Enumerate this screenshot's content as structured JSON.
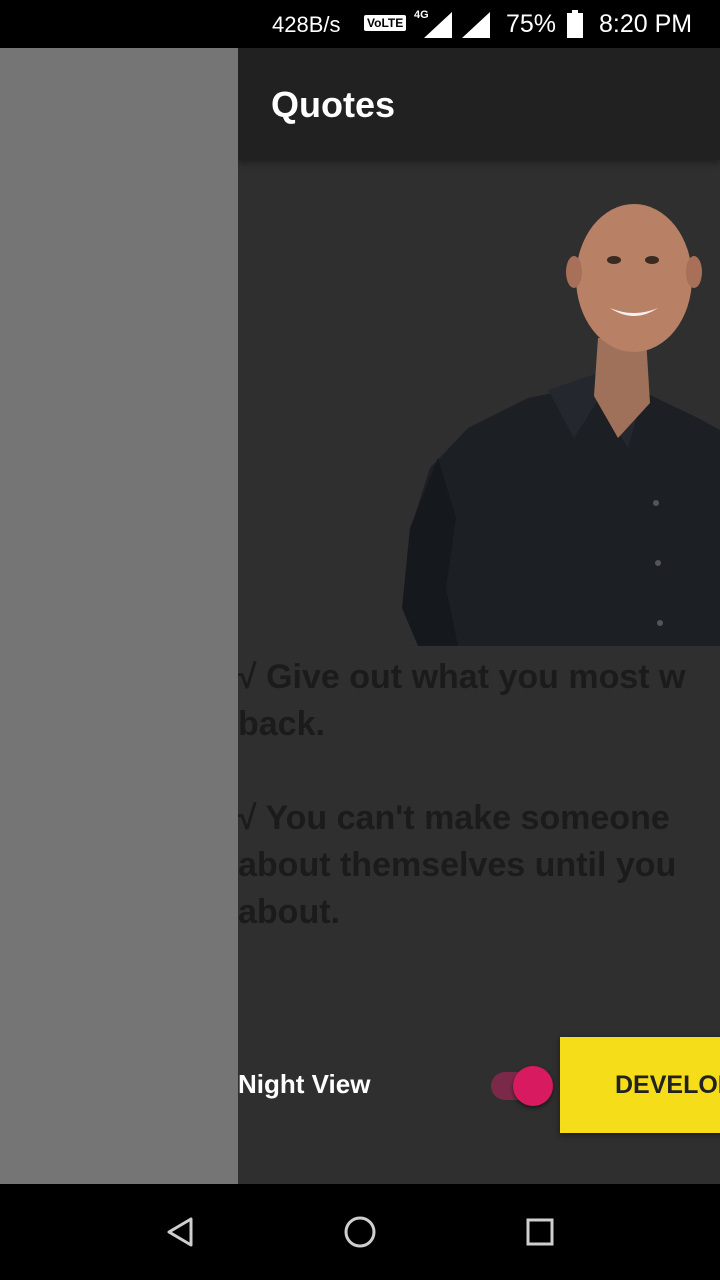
{
  "status_bar": {
    "net_speed": "428B/s",
    "volte": "VoLTE",
    "network_type": "4G",
    "battery_percent": "75%",
    "time": "8:20 PM"
  },
  "app": {
    "title": "Quotes",
    "quotes": [
      {
        "line1": "√ Give out what you most w",
        "line2": "back."
      },
      {
        "line1": "√ You can't make someone",
        "line2": "about themselves until you",
        "line3": "about."
      }
    ],
    "night_view_label": "Night View",
    "night_view_on": true,
    "developer_button_label": "DEVELOPER"
  },
  "colors": {
    "toolbar": "#212121",
    "background": "#2f2f2f",
    "scrim": "#757575",
    "toggle_accent": "#d81b60",
    "developer_button": "#f5de19"
  },
  "icons": {
    "back": "triangle-back-icon",
    "home": "circle-home-icon",
    "recent": "square-recent-icon"
  }
}
